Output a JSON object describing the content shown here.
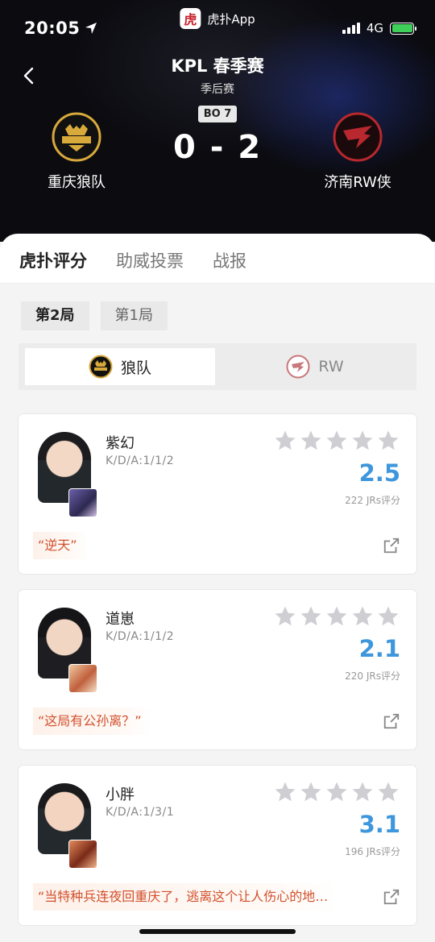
{
  "status_bar": {
    "time": "20:05",
    "app_name": "虎扑App",
    "app_logo_char": "虎",
    "network": "4G"
  },
  "match": {
    "title": "KPL 春季赛",
    "stage": "季后赛",
    "format": "BO 7",
    "score": "0 - 2",
    "home_team": "重庆狼队",
    "away_team": "济南RW侠"
  },
  "tabs": [
    "虎扑评分",
    "助威投票",
    "战报"
  ],
  "games": [
    "第2局",
    "第1局"
  ],
  "team_toggle": {
    "home": "狼队",
    "away": "RW"
  },
  "players": [
    {
      "name": "紫幻",
      "kda": "K/D/A:1/1/2",
      "rating": "2.5",
      "votes": "222 JRs评分",
      "quote": "“逆天”"
    },
    {
      "name": "道崽",
      "kda": "K/D/A:1/1/2",
      "rating": "2.1",
      "votes": "220 JRs评分",
      "quote": "“这局有公孙离？”"
    },
    {
      "name": "小胖",
      "kda": "K/D/A:1/3/1",
      "rating": "3.1",
      "votes": "196 JRs评分",
      "quote": "“当特种兵连夜回重庆了，逃离这个让人伤心的地…"
    }
  ],
  "colors": {
    "accent": "#c8202b",
    "rating": "#3e97dc",
    "quote": "#d2502c"
  },
  "icons": {
    "back": "chevron-left-icon",
    "share": "share-icon",
    "star": "star-icon",
    "location": "location-arrow-icon"
  }
}
